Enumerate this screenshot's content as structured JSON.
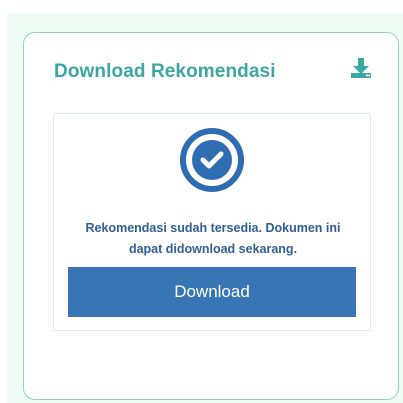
{
  "card": {
    "title": "Download Rekomendasi",
    "header_icon": "download-icon"
  },
  "status": {
    "icon": "check-circle-icon",
    "message_line1": "Rekomendasi sudah tersedia. Dokumen ini",
    "message_line2": "dapat didownload sekarang."
  },
  "actions": {
    "download_label": "Download"
  },
  "colors": {
    "title": "#3aa6a6",
    "accent": "#3775b5",
    "check_circle": "#2f6db3",
    "background": "#eefcf3"
  }
}
